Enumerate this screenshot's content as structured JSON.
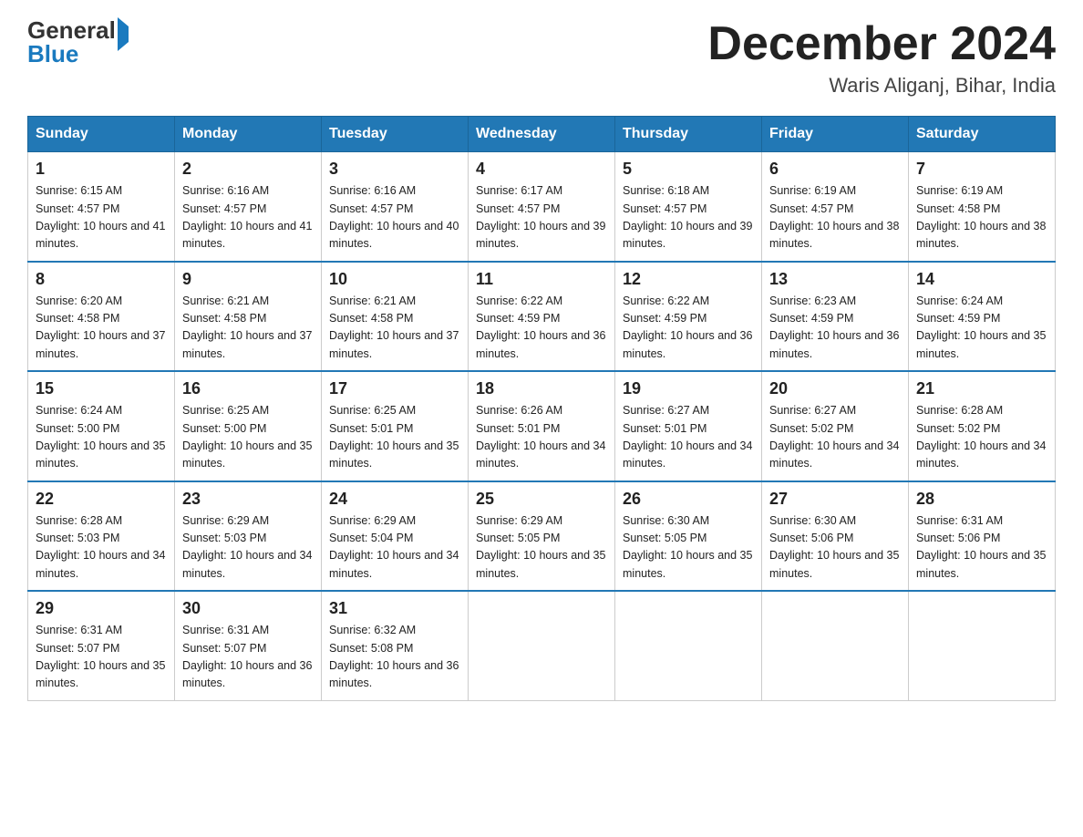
{
  "header": {
    "logo_general": "General",
    "logo_blue": "Blue",
    "month_title": "December 2024",
    "subtitle": "Waris Aliganj, Bihar, India"
  },
  "days_of_week": [
    "Sunday",
    "Monday",
    "Tuesday",
    "Wednesday",
    "Thursday",
    "Friday",
    "Saturday"
  ],
  "weeks": [
    [
      {
        "day": "1",
        "sunrise": "6:15 AM",
        "sunset": "4:57 PM",
        "daylight": "10 hours and 41 minutes."
      },
      {
        "day": "2",
        "sunrise": "6:16 AM",
        "sunset": "4:57 PM",
        "daylight": "10 hours and 41 minutes."
      },
      {
        "day": "3",
        "sunrise": "6:16 AM",
        "sunset": "4:57 PM",
        "daylight": "10 hours and 40 minutes."
      },
      {
        "day": "4",
        "sunrise": "6:17 AM",
        "sunset": "4:57 PM",
        "daylight": "10 hours and 39 minutes."
      },
      {
        "day": "5",
        "sunrise": "6:18 AM",
        "sunset": "4:57 PM",
        "daylight": "10 hours and 39 minutes."
      },
      {
        "day": "6",
        "sunrise": "6:19 AM",
        "sunset": "4:57 PM",
        "daylight": "10 hours and 38 minutes."
      },
      {
        "day": "7",
        "sunrise": "6:19 AM",
        "sunset": "4:58 PM",
        "daylight": "10 hours and 38 minutes."
      }
    ],
    [
      {
        "day": "8",
        "sunrise": "6:20 AM",
        "sunset": "4:58 PM",
        "daylight": "10 hours and 37 minutes."
      },
      {
        "day": "9",
        "sunrise": "6:21 AM",
        "sunset": "4:58 PM",
        "daylight": "10 hours and 37 minutes."
      },
      {
        "day": "10",
        "sunrise": "6:21 AM",
        "sunset": "4:58 PM",
        "daylight": "10 hours and 37 minutes."
      },
      {
        "day": "11",
        "sunrise": "6:22 AM",
        "sunset": "4:59 PM",
        "daylight": "10 hours and 36 minutes."
      },
      {
        "day": "12",
        "sunrise": "6:22 AM",
        "sunset": "4:59 PM",
        "daylight": "10 hours and 36 minutes."
      },
      {
        "day": "13",
        "sunrise": "6:23 AM",
        "sunset": "4:59 PM",
        "daylight": "10 hours and 36 minutes."
      },
      {
        "day": "14",
        "sunrise": "6:24 AM",
        "sunset": "4:59 PM",
        "daylight": "10 hours and 35 minutes."
      }
    ],
    [
      {
        "day": "15",
        "sunrise": "6:24 AM",
        "sunset": "5:00 PM",
        "daylight": "10 hours and 35 minutes."
      },
      {
        "day": "16",
        "sunrise": "6:25 AM",
        "sunset": "5:00 PM",
        "daylight": "10 hours and 35 minutes."
      },
      {
        "day": "17",
        "sunrise": "6:25 AM",
        "sunset": "5:01 PM",
        "daylight": "10 hours and 35 minutes."
      },
      {
        "day": "18",
        "sunrise": "6:26 AM",
        "sunset": "5:01 PM",
        "daylight": "10 hours and 34 minutes."
      },
      {
        "day": "19",
        "sunrise": "6:27 AM",
        "sunset": "5:01 PM",
        "daylight": "10 hours and 34 minutes."
      },
      {
        "day": "20",
        "sunrise": "6:27 AM",
        "sunset": "5:02 PM",
        "daylight": "10 hours and 34 minutes."
      },
      {
        "day": "21",
        "sunrise": "6:28 AM",
        "sunset": "5:02 PM",
        "daylight": "10 hours and 34 minutes."
      }
    ],
    [
      {
        "day": "22",
        "sunrise": "6:28 AM",
        "sunset": "5:03 PM",
        "daylight": "10 hours and 34 minutes."
      },
      {
        "day": "23",
        "sunrise": "6:29 AM",
        "sunset": "5:03 PM",
        "daylight": "10 hours and 34 minutes."
      },
      {
        "day": "24",
        "sunrise": "6:29 AM",
        "sunset": "5:04 PM",
        "daylight": "10 hours and 34 minutes."
      },
      {
        "day": "25",
        "sunrise": "6:29 AM",
        "sunset": "5:05 PM",
        "daylight": "10 hours and 35 minutes."
      },
      {
        "day": "26",
        "sunrise": "6:30 AM",
        "sunset": "5:05 PM",
        "daylight": "10 hours and 35 minutes."
      },
      {
        "day": "27",
        "sunrise": "6:30 AM",
        "sunset": "5:06 PM",
        "daylight": "10 hours and 35 minutes."
      },
      {
        "day": "28",
        "sunrise": "6:31 AM",
        "sunset": "5:06 PM",
        "daylight": "10 hours and 35 minutes."
      }
    ],
    [
      {
        "day": "29",
        "sunrise": "6:31 AM",
        "sunset": "5:07 PM",
        "daylight": "10 hours and 35 minutes."
      },
      {
        "day": "30",
        "sunrise": "6:31 AM",
        "sunset": "5:07 PM",
        "daylight": "10 hours and 36 minutes."
      },
      {
        "day": "31",
        "sunrise": "6:32 AM",
        "sunset": "5:08 PM",
        "daylight": "10 hours and 36 minutes."
      },
      null,
      null,
      null,
      null
    ]
  ],
  "labels": {
    "sunrise_prefix": "Sunrise: ",
    "sunset_prefix": "Sunset: ",
    "daylight_prefix": "Daylight: "
  }
}
